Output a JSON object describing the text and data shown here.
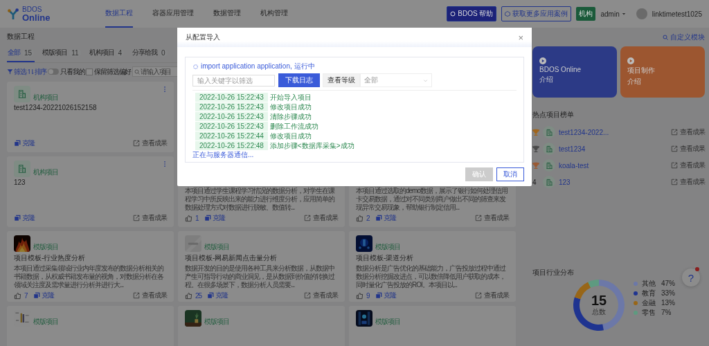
{
  "header": {
    "logo_small": "BDOS",
    "logo_text": "Online",
    "nav": [
      {
        "label": "数据工程",
        "selected": true
      },
      {
        "label": "容器应用管理",
        "selected": false
      },
      {
        "label": "数据管理",
        "selected": false
      },
      {
        "label": "机构管理",
        "selected": false
      }
    ],
    "help_button": "BDOS 帮助",
    "cases_button": "获取更多应用案例",
    "org_tag": "机构",
    "user_menu": "admin",
    "username": "linktimetest1025"
  },
  "main": {
    "title": "数据工程",
    "tabs": [
      {
        "label": "全部",
        "count": "15",
        "selected": true
      },
      {
        "label": "模版项目",
        "count": "11",
        "selected": false
      },
      {
        "label": "机构项目",
        "count": "4",
        "selected": false
      },
      {
        "label": "分享给我",
        "count": "0",
        "selected": false
      }
    ],
    "filter": {
      "filter_label": "筛选",
      "sort_label": "排序",
      "mine_toggle": {
        "label": "只看我的",
        "on": false
      },
      "keep_checkbox": {
        "label": "保留筛选偏好",
        "checked": false
      },
      "search": {
        "placeholder": "请输入项目"
      }
    },
    "card_rows": [
      [
        {
          "kind": "org",
          "tag": "机构项目",
          "title": "test1234-20221026152158",
          "clone": "克隆",
          "result": "查看成果"
        }
      ],
      [
        {
          "kind": "org",
          "tag": "机构项目",
          "title": "123",
          "clone": "克隆",
          "result": "查看成果"
        },
        {
          "kind": "template",
          "description": "本项目通过学生课程学习情况的数据分析，对学生在课程学习中所反映出来的能力进行维度分析，应用简单的数据处理方式对数据进行脱敏、数值转...",
          "likes": "1",
          "clone": "克隆",
          "result": "查看成果"
        },
        {
          "kind": "template",
          "description": "本项目通过选取的demo数据，展示了银行如何处理信用卡交易数据，通过对不同类别商户做出不同的筛查来发现异常交易现象，帮助银行制定信用...",
          "likes": "2",
          "clone": "克隆",
          "result": "查看成果"
        }
      ],
      [
        {
          "kind": "template",
          "tag": "模版项目",
          "title": "项目模板-行业热度分析",
          "description": "本项目通过采集领域行业内年度发布的数据分析相关的书籍数据，从权威书籍发布量的视角，对数据分析在各领域关注度及需求量进行分析并进行大...",
          "likes": "7",
          "clone": "克隆",
          "result": "查看成果"
        },
        {
          "kind": "template",
          "tag": "模版项目",
          "title": "项目模板-网易新闻点击量分析",
          "description": "数据开发的目的是使用各种工具来分析数据，从数据中产生可指导行动的商业洞见，是从数据到价值的转换过程。在很多场景下，数据分析人员需要...",
          "likes": "25",
          "clone": "克隆",
          "result": "查看成果"
        },
        {
          "kind": "template",
          "tag": "模版项目",
          "title": "项目模板-渠道分析",
          "description": "数据分析是广告优化的基础能力，广告投放过程中通过数据分析挖掘改进点，可以数倍降低用户获取的成本，同时量化广告投放的ROI。本项目以...",
          "likes": "9",
          "clone": "克隆",
          "result": "查看成果"
        }
      ],
      [
        {
          "kind": "template",
          "tag": "模版项目"
        },
        {
          "kind": "template",
          "tag": "模版项目"
        },
        {
          "kind": "template",
          "tag": "模版项目"
        }
      ]
    ]
  },
  "right": {
    "customize": "自定义模块",
    "banners": [
      {
        "title": "BDOS Online",
        "subtitle": "介绍",
        "color": "#2c3a86"
      },
      {
        "title": "项目制作",
        "subtitle": "介绍",
        "color": "#9c5630"
      }
    ],
    "hot": {
      "title": "热点项目榜单",
      "items": [
        {
          "kind": "trophy",
          "color": "#a0651c",
          "name": "test1234-2022...",
          "result": "查看成果"
        },
        {
          "kind": "trophy",
          "color": "#4a4a4a",
          "name": "test1234",
          "result": "查看成果"
        },
        {
          "kind": "trophy",
          "color": "#9a5a34",
          "name": "koala-test",
          "result": "查看成果"
        },
        {
          "kind": "rank",
          "rank": "4",
          "name": "123",
          "result": "查看成果"
        }
      ]
    },
    "distribution": {
      "title": "项目行业分布",
      "total": "15",
      "total_label": "总数",
      "chart_data": {
        "type": "donut",
        "categories": [
          "其他",
          "教育",
          "金融",
          "零售"
        ],
        "values": [
          47,
          33,
          13,
          7
        ]
      },
      "legend": [
        {
          "percent": "47%",
          "color": "#6c78a8"
        },
        {
          "percent": "33%",
          "color": "#1f3490"
        },
        {
          "percent": "13%",
          "color": "#986618"
        },
        {
          "percent": "7%",
          "color": "#5e9a80"
        }
      ]
    }
  },
  "help": {
    "label": "?",
    "notification_dot": true
  },
  "modal": {
    "title": "从配置导入",
    "close": "×",
    "status": "import application application, 运行中",
    "filter_placeholder": "输入关键字以筛选",
    "download_button": "下载日志",
    "level_label": "查看等级",
    "level_select": "全部",
    "logs": [
      {
        "time": "2022-10-26 15:22:43",
        "message": "开始导入项目"
      },
      {
        "time": "2022-10-26 15:22:43",
        "message": "修改项目成功"
      },
      {
        "time": "2022-10-26 15:22:43",
        "message": "清除步骤成功"
      },
      {
        "time": "2022-10-26 15:22:43",
        "message": "删除工作流成功"
      },
      {
        "time": "2022-10-26 15:22:44",
        "message": "修改项目成功"
      },
      {
        "time": "2022-10-26 15:22:48",
        "message": "添加步骤<数据库采集>成功"
      }
    ],
    "progress_text": "正在与服务器通信...",
    "confirm": {
      "label": "确认",
      "disabled": true
    },
    "cancel": "取消"
  }
}
